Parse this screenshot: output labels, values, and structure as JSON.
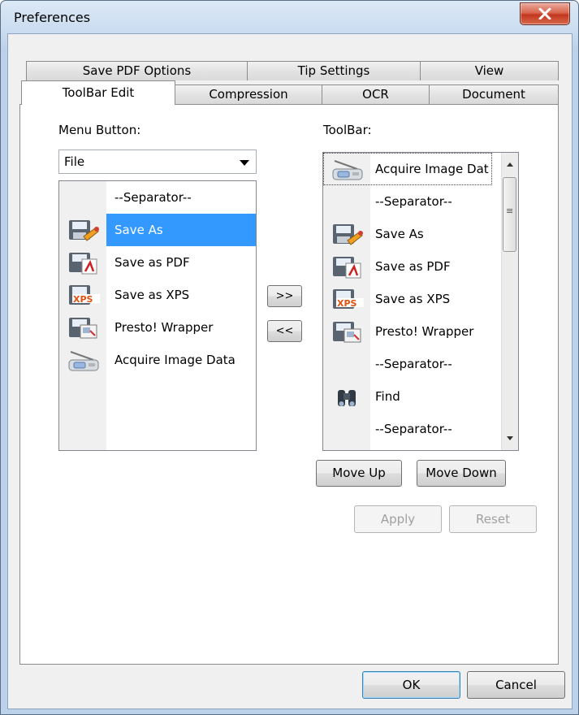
{
  "window": {
    "title": "Preferences"
  },
  "tabs": {
    "row_back": [
      "Save PDF Options",
      "Tip Settings",
      "View"
    ],
    "row_front": [
      "ToolBar Edit",
      "Compression",
      "OCR",
      "Document"
    ],
    "active": "ToolBar Edit"
  },
  "menu_button": {
    "label": "Menu Button:",
    "selected": "File",
    "items": [
      {
        "label": "--Separator--",
        "icon": "none"
      },
      {
        "label": "Save As",
        "icon": "save-as-icon",
        "selected": true
      },
      {
        "label": "Save as PDF",
        "icon": "save-pdf-icon"
      },
      {
        "label": "Save as XPS",
        "icon": "save-xps-icon"
      },
      {
        "label": "Presto! Wrapper",
        "icon": "presto-wrapper-icon"
      },
      {
        "label": "Acquire Image Data",
        "icon": "scanner-icon"
      }
    ]
  },
  "toolbar": {
    "label": "ToolBar:",
    "items": [
      {
        "label": "Acquire Image Dat",
        "icon": "scanner-icon",
        "focused": true
      },
      {
        "label": "--Separator--",
        "icon": "none"
      },
      {
        "label": "Save As",
        "icon": "save-as-icon"
      },
      {
        "label": "Save as PDF",
        "icon": "save-pdf-icon"
      },
      {
        "label": "Save as XPS",
        "icon": "save-xps-icon"
      },
      {
        "label": "Presto! Wrapper",
        "icon": "presto-wrapper-icon"
      },
      {
        "label": "--Separator--",
        "icon": "none"
      },
      {
        "label": "Find",
        "icon": "binoculars-icon"
      },
      {
        "label": "--Separator--",
        "icon": "none"
      }
    ]
  },
  "buttons": {
    "add": ">>",
    "remove": "<<",
    "move_up": "Move Up",
    "move_down": "Move Down",
    "apply": "Apply",
    "reset": "Reset",
    "ok": "OK",
    "cancel": "Cancel"
  },
  "colors": {
    "selection": "#3399ff",
    "title_bar": "#c9dbef",
    "close_button": "#c2371e"
  }
}
